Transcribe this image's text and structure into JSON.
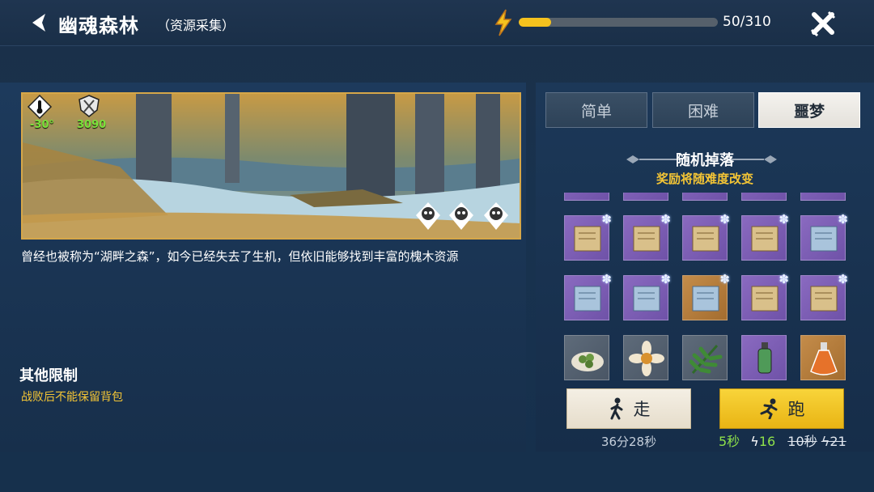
{
  "header": {
    "title": "幽魂森林",
    "subtitle": "（资源采集）",
    "energy_text": "50/310",
    "energy_fraction": 0.161
  },
  "banner": {
    "temperature": "-30°",
    "power": "3090"
  },
  "description": "曾经也被称为“湖畔之森”，如今已经失去了生机，但依旧能够找到丰富的槐木资源",
  "limits": {
    "title": "其他限制",
    "text": "战败后不能保留背包"
  },
  "tabs": [
    {
      "label": "简单",
      "active": false
    },
    {
      "label": "困难",
      "active": false
    },
    {
      "label": "噩梦",
      "active": true
    }
  ],
  "drops": {
    "title": "随机掉落",
    "subtitle": "奖励将随难度改变"
  },
  "actions": {
    "walk_label": "走",
    "walk_time": "36分28秒",
    "run_label": "跑",
    "run_time": "5秒",
    "run_cost": "16",
    "run_old_time": "10秒",
    "run_old_cost": "21"
  },
  "colors": {
    "energy": "#f5c21e",
    "accent_yellow": "#f4c535",
    "green_stat": "#7ae23a",
    "rarity_purple": "#7a5cb4",
    "rarity_orange": "#b47b3b"
  }
}
